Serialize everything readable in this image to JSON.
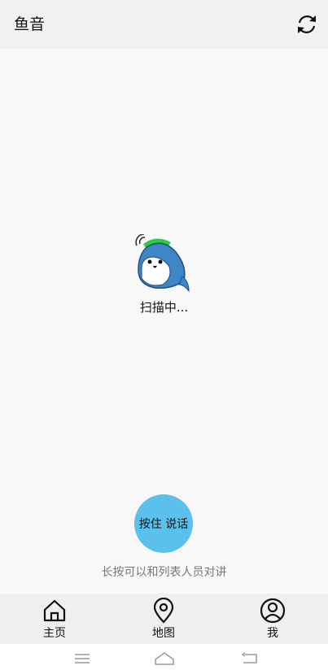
{
  "header": {
    "title": "鱼音",
    "refresh_icon": "refresh-icon"
  },
  "main": {
    "mascot_icon": "fish-mascot-icon",
    "scan_status": "扫描中...",
    "ptt_label": "按住 说话",
    "hint": "长按可以和列表人员对讲"
  },
  "tabs": [
    {
      "label": "主页",
      "icon": "home-icon"
    },
    {
      "label": "地图",
      "icon": "map-pin-icon"
    },
    {
      "label": "我",
      "icon": "user-icon"
    }
  ],
  "system_nav": {
    "icons": [
      "menu-icon",
      "home-outline-icon",
      "back-icon"
    ]
  },
  "colors": {
    "header_bg": "#f1f1f1",
    "page_bg": "#f8f8f8",
    "ptt_button": "#5bc0eb",
    "tabbar_bg": "#efefef",
    "mascot_blue": "#3f86c6",
    "mascot_green": "#2ecc40"
  }
}
